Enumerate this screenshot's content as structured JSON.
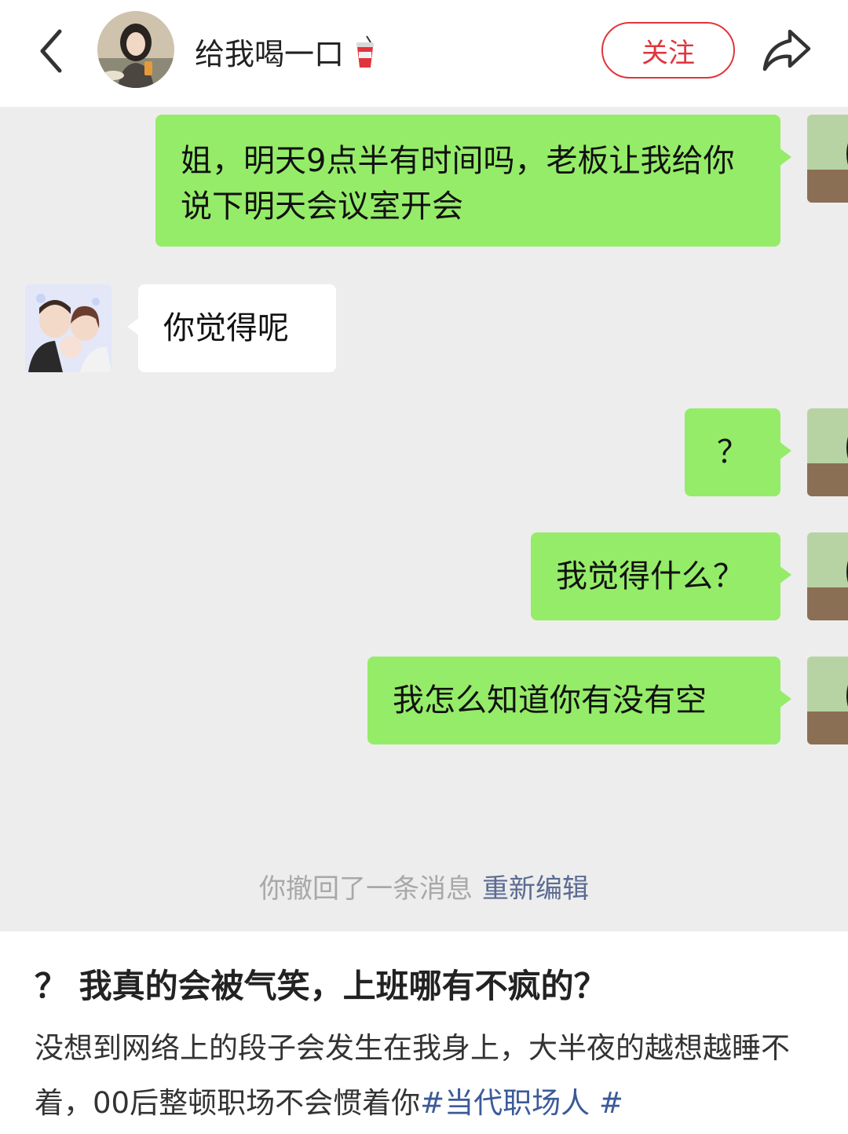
{
  "header": {
    "username": "给我喝一口",
    "follow_label": "关注"
  },
  "messages": [
    {
      "side": "me",
      "text": "姐，明天9点半有时间吗，老板让我给你说下明天会议室开会"
    },
    {
      "side": "other",
      "text": "你觉得呢"
    },
    {
      "side": "me",
      "text": "？"
    },
    {
      "side": "me",
      "text": "我觉得什么？"
    },
    {
      "side": "me",
      "text": "我怎么知道你有没有空"
    }
  ],
  "system_notice": {
    "text": "你撤回了一条消息",
    "action": "重新编辑"
  },
  "post": {
    "title": "？ 我真的会被气笑，上班哪有不疯的？",
    "body_text": "没想到网络上的段子会发生在我身上，大半夜的越想越睡不着，00后整顿职场不会惯着你",
    "hashtag": "#当代职场人 #"
  },
  "colors": {
    "accent_red": "#e0353c",
    "bubble_green": "#95ec69",
    "chat_bg": "#ededed",
    "link_blue": "#5b6b92"
  }
}
